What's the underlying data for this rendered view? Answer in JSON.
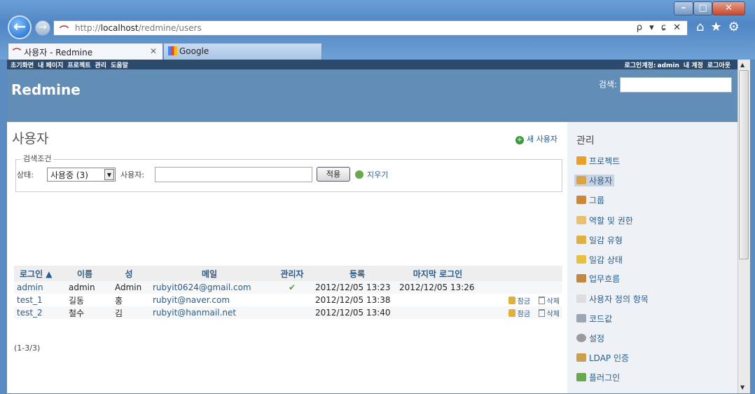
{
  "browser": {
    "url_prefix": "http://",
    "url_host": "localhost",
    "url_path": "/redmine/users",
    "addr_tools": "ρ ▾ ɕ ✕",
    "nav_icons": "⌂★⚙",
    "tabs": [
      {
        "label": "사용자 - Redmine"
      },
      {
        "label": "Google"
      }
    ],
    "window_buttons": {
      "minimize": "–",
      "maximize": "□",
      "close": "✕"
    }
  },
  "topmenu": {
    "items": [
      "초기화면",
      "내 페이지",
      "프로젝트",
      "관리",
      "도움말"
    ],
    "logged_in_label": "로그인계정:",
    "logged_in_user": "admin",
    "my_account": "내 계정",
    "logout": "로그아웃"
  },
  "header": {
    "title": "Redmine",
    "search_label": "검색:"
  },
  "main": {
    "title": "사용자",
    "new_user": "새 사용자",
    "filter": {
      "legend": "검색조건",
      "status_label": "상태:",
      "status_value": "사용중 (3)",
      "user_label": "사용자:",
      "user_value": "",
      "apply": "적용",
      "clear": "지우기"
    },
    "table": {
      "columns": [
        "로그인 ▲",
        "이름",
        "성",
        "메일",
        "관리자",
        "등록",
        "마지막 로그인"
      ],
      "rows": [
        {
          "login": "admin",
          "first": "admin",
          "last": "Admin",
          "mail": "rubyit0624@gmail.com",
          "admin": "✔",
          "created": "2012/12/05 13:23",
          "last_login": "2012/12/05 13:26",
          "lock": "",
          "delete": ""
        },
        {
          "login": "test_1",
          "first": "길동",
          "last": "홍",
          "mail": "rubyit@naver.com",
          "admin": "",
          "created": "2012/12/05 13:38",
          "last_login": "",
          "lock": "잠금",
          "delete": "삭제"
        },
        {
          "login": "test_2",
          "first": "철수",
          "last": "김",
          "mail": "rubyit@hanmail.net",
          "admin": "",
          "created": "2012/12/05 13:40",
          "last_login": "",
          "lock": "잠금",
          "delete": "삭제"
        }
      ]
    },
    "pagination": "(1-3/3)"
  },
  "sidebar": {
    "title": "관리",
    "items": [
      {
        "label": "프로젝트",
        "icon": "projects-icon",
        "color": "#e8a02a"
      },
      {
        "label": "사용자",
        "icon": "user-icon",
        "color": "#d9a34a",
        "selected": true
      },
      {
        "label": "그룹",
        "icon": "group-icon",
        "color": "#c9883a"
      },
      {
        "label": "역할 및 권한",
        "icon": "role-icon",
        "color": "#e8c070"
      },
      {
        "label": "일감 유형",
        "icon": "tracker-icon",
        "color": "#e0b040"
      },
      {
        "label": "일감 상태",
        "icon": "status-icon",
        "color": "#e8c040"
      },
      {
        "label": "업무흐름",
        "icon": "workflow-icon",
        "color": "#c08840"
      },
      {
        "label": "사용자 정의 항목",
        "icon": "custom-field-icon",
        "color": "#dddddd"
      },
      {
        "label": "코드값",
        "icon": "list-icon",
        "color": "#9aa6b4"
      },
      {
        "label": "설정",
        "icon": "gear-icon",
        "color": "#9a9a9a"
      },
      {
        "label": "LDAP 인증",
        "icon": "ldap-icon",
        "color": "#c8a050"
      },
      {
        "label": "플러그인",
        "icon": "plugin-icon",
        "color": "#6aa84f"
      }
    ]
  }
}
